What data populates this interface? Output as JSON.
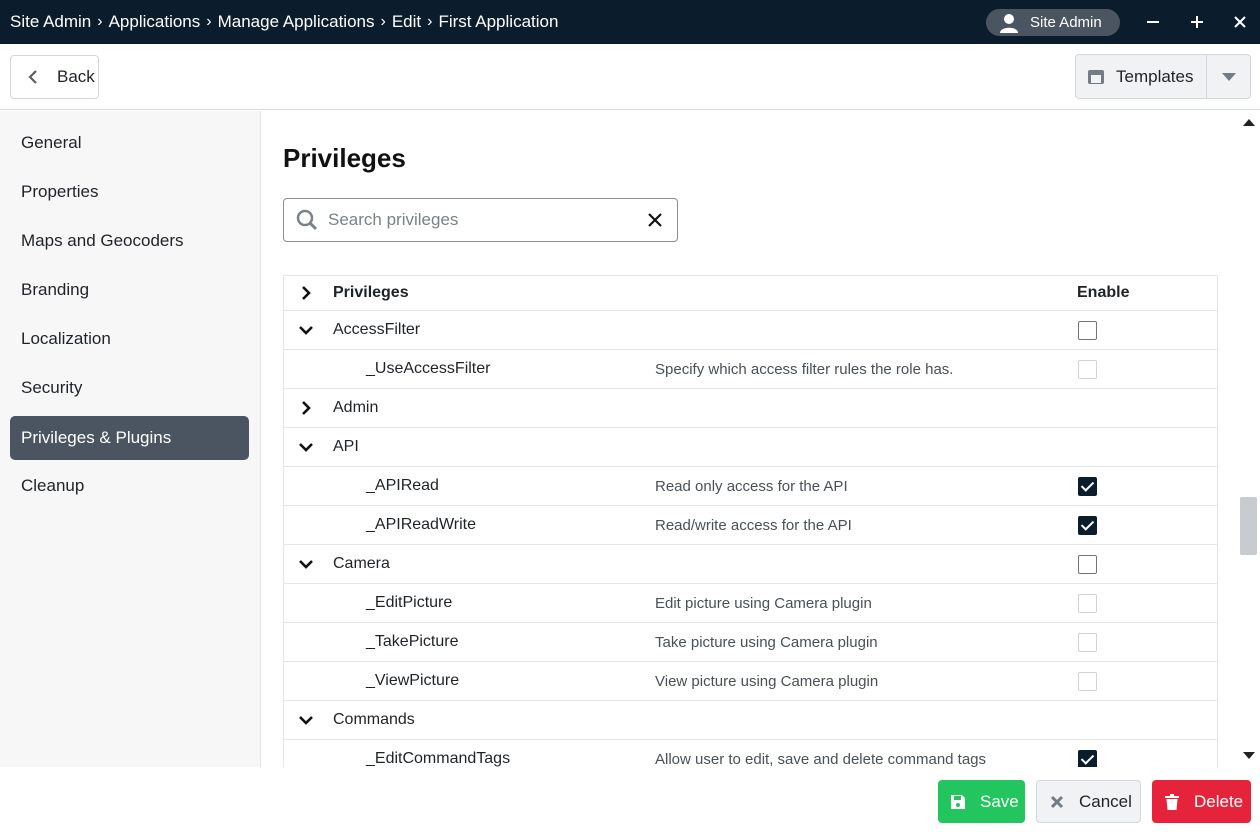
{
  "titlebar": {
    "crumbs": [
      "Site Admin",
      "Applications",
      "Manage Applications",
      "Edit",
      "First Application"
    ],
    "separator": "›",
    "user": "Site Admin",
    "minimize": "−",
    "maximize": "+",
    "close": "✕"
  },
  "toolbar": {
    "back_label": "Back",
    "templates_label": "Templates"
  },
  "sidebar": {
    "items": [
      {
        "label": "General"
      },
      {
        "label": "Properties"
      },
      {
        "label": "Maps and Geocoders"
      },
      {
        "label": "Branding"
      },
      {
        "label": "Localization"
      },
      {
        "label": "Security"
      },
      {
        "label": "Privileges & Plugins",
        "active": true
      },
      {
        "label": "Cleanup"
      }
    ]
  },
  "main": {
    "title": "Privileges",
    "search": {
      "placeholder": "Search privileges",
      "value": ""
    },
    "table": {
      "header": {
        "name": "Privileges",
        "enable": "Enable"
      },
      "rows": [
        {
          "type": "group",
          "name": "AccessFilter",
          "expanded": true,
          "checkbox": "unchecked"
        },
        {
          "type": "child",
          "name": "_UseAccessFilter",
          "desc": "Specify which access filter rules the role has.",
          "checkbox": "unchecked-light"
        },
        {
          "type": "group",
          "name": "Admin",
          "expanded": false,
          "checkbox": "none"
        },
        {
          "type": "group",
          "name": "API",
          "expanded": true,
          "checkbox": "none"
        },
        {
          "type": "child",
          "name": "_APIRead",
          "desc": "Read only access for the API",
          "checkbox": "checked"
        },
        {
          "type": "child",
          "name": "_APIReadWrite",
          "desc": "Read/write access for the API",
          "checkbox": "checked"
        },
        {
          "type": "group",
          "name": "Camera",
          "expanded": true,
          "checkbox": "unchecked"
        },
        {
          "type": "child",
          "name": "_EditPicture",
          "desc": "Edit picture using Camera plugin",
          "checkbox": "unchecked-light"
        },
        {
          "type": "child",
          "name": "_TakePicture",
          "desc": "Take picture using Camera plugin",
          "checkbox": "unchecked-light"
        },
        {
          "type": "child",
          "name": "_ViewPicture",
          "desc": "View picture using Camera plugin",
          "checkbox": "unchecked-light"
        },
        {
          "type": "group",
          "name": "Commands",
          "expanded": true,
          "checkbox": "none"
        },
        {
          "type": "child",
          "name": "_EditCommandTags",
          "desc": "Allow user to edit, save and delete command tags",
          "checkbox": "checked"
        }
      ]
    }
  },
  "footer": {
    "save_label": "Save",
    "cancel_label": "Cancel",
    "delete_label": "Delete"
  },
  "colors": {
    "titlebar_bg": "#0b1d2c",
    "active_nav": "#4b5561",
    "save": "#22c55e",
    "delete": "#e5243b"
  }
}
